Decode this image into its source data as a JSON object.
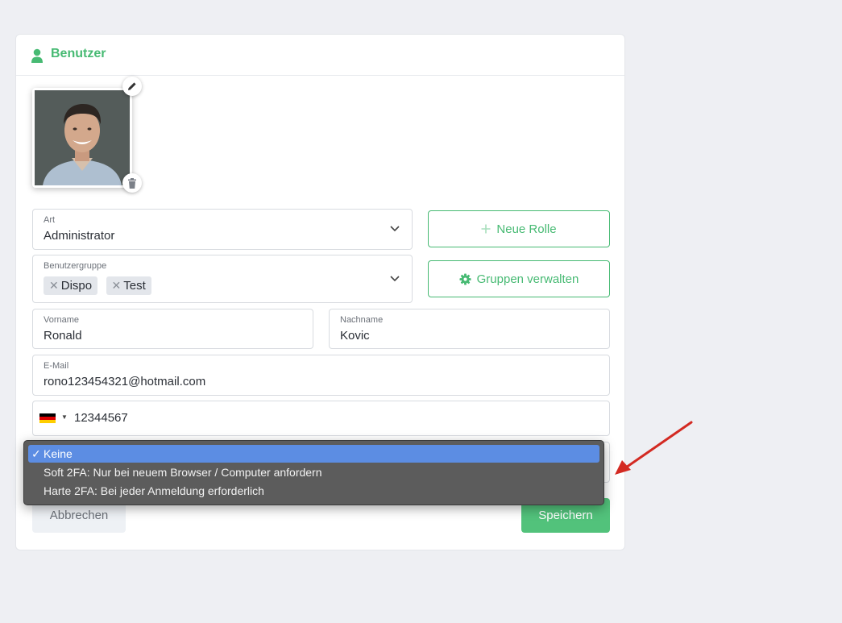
{
  "card": {
    "title": "Benutzer"
  },
  "form": {
    "art": {
      "label": "Art",
      "value": "Administrator"
    },
    "benutzergruppe": {
      "label": "Benutzergruppe",
      "tags": [
        "Dispo",
        "Test"
      ]
    },
    "vorname": {
      "label": "Vorname",
      "value": "Ronald"
    },
    "nachname": {
      "label": "Nachname",
      "value": "Kovic"
    },
    "email": {
      "label": "E-Mail",
      "value": "rono123454321@hotmail.com"
    },
    "phone": {
      "country": "DE",
      "value": "12344567"
    }
  },
  "buttons": {
    "neue_rolle": "Neue Rolle",
    "gruppen_verwalten": "Gruppen verwalten",
    "abbrechen": "Abbrechen",
    "speichern": "Speichern"
  },
  "two_fa_dropdown": {
    "check": "✓",
    "options": [
      {
        "label": "Keine",
        "selected": true
      },
      {
        "label": "Soft 2FA: Nur bei neuem Browser / Computer anfordern",
        "selected": false
      },
      {
        "label": "Harte 2FA: Bei jeder Anmeldung erforderlich",
        "selected": false
      }
    ]
  },
  "icons": {
    "user": "user-icon",
    "edit": "pencil-icon",
    "delete": "trash-icon",
    "chevron": "chevron-down-icon",
    "plus": "plus-icon",
    "gear": "gear-icon",
    "remove": "close-icon"
  },
  "colors": {
    "accent": "#47ba73",
    "save_bg": "#52c27b",
    "dropdown_bg": "#5c5c5c",
    "dropdown_selected": "#5c8de3",
    "arrow": "#d32a22"
  }
}
